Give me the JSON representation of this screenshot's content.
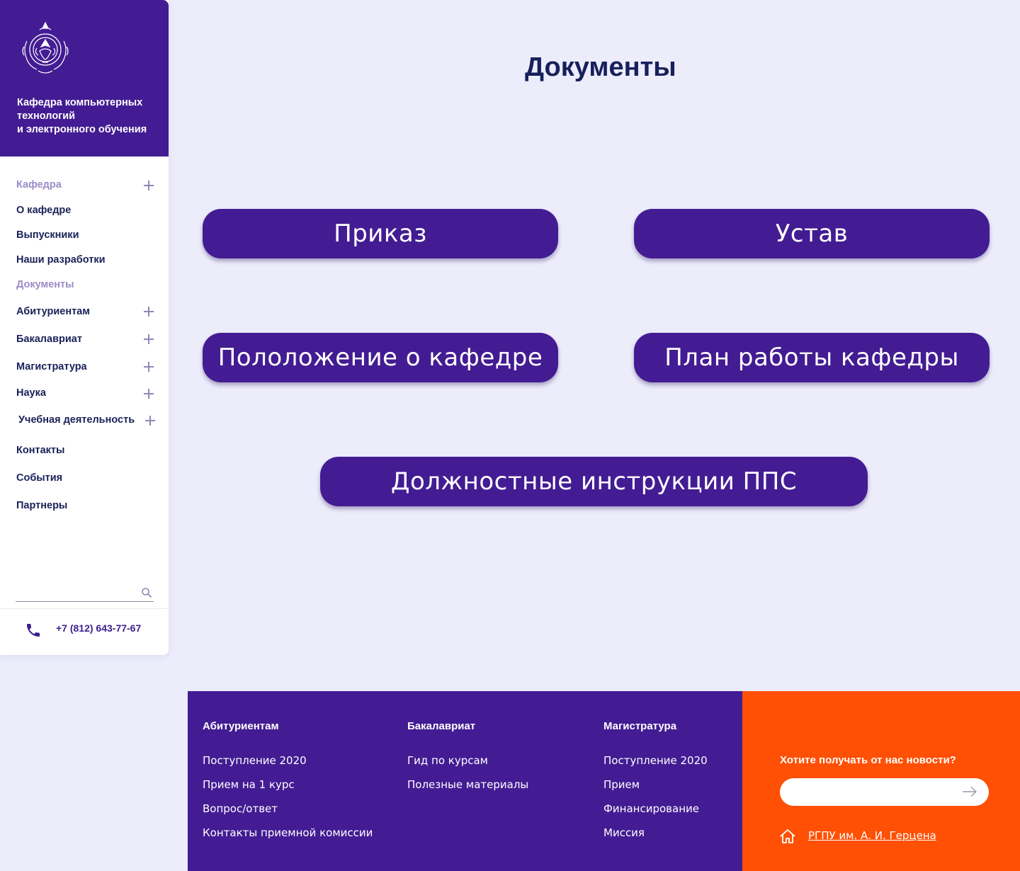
{
  "sidebar": {
    "department_lines": [
      "Кафедра компьютерных",
      "технологий",
      "и электронного обучения"
    ],
    "nav": [
      {
        "label": "Кафедра",
        "expandable": true,
        "muted": true
      },
      {
        "label": "О кафедре"
      },
      {
        "label": "Выпускники"
      },
      {
        "label": "Наши разработки"
      },
      {
        "label": "Документы",
        "muted": true
      },
      {
        "label": "Абитуриентам",
        "expandable": true
      },
      {
        "label": "Бакалавриат",
        "expandable": true
      },
      {
        "label": "Магистратура",
        "expandable": true
      },
      {
        "label": "Наука",
        "expandable": true
      },
      {
        "label": "Учебная деятельность",
        "expandable": true
      },
      {
        "label": "Контакты"
      },
      {
        "label": "События"
      },
      {
        "label": "Партнеры"
      }
    ],
    "search": {
      "placeholder": "",
      "value": ""
    },
    "phone": "+7 (812) 643-77-67"
  },
  "main": {
    "title": "Документы",
    "documents": [
      {
        "label": "Приказ"
      },
      {
        "label": "Устав"
      },
      {
        "label": "Пололожение о кафедре"
      },
      {
        "label": "План работы кафедры"
      },
      {
        "label": "Должностные инструкции ППС"
      }
    ]
  },
  "footer": {
    "columns": [
      {
        "heading": "Абитуриентам",
        "links": [
          "Поступление 2020",
          "Прием на 1 курс",
          "Вопрос/ответ",
          "Контакты приемной комиссии"
        ]
      },
      {
        "heading": "Бакалавриат",
        "links": [
          "Гид по курсам",
          "Полезные материалы"
        ]
      },
      {
        "heading": "Магистратура",
        "links": [
          "Поступление 2020",
          "Прием",
          "Финансирование",
          "Миссия"
        ]
      }
    ],
    "subscribe": {
      "title": "Хотите получать от нас новости?",
      "placeholder": "",
      "university_link": "РГПУ им. А. И. Герцена"
    }
  },
  "colors": {
    "primary": "#431c93",
    "accent": "#ff5005",
    "background": "#ececfb",
    "heading": "#16205a"
  },
  "icons": [
    "university-emblem-icon",
    "plus-icon",
    "search-icon",
    "phone-icon",
    "arrow-right-icon",
    "home-icon"
  ]
}
